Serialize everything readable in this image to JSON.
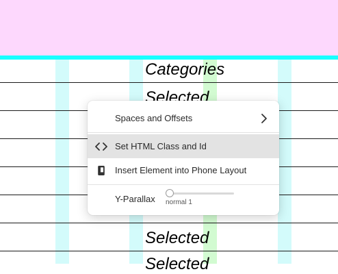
{
  "canvas": {
    "texts": [
      "Categories",
      "Selected",
      "Selected",
      "Selected"
    ]
  },
  "context_menu": {
    "items": [
      {
        "label": "Spaces and Offsets",
        "icon": "chevron-right-icon"
      },
      {
        "label": "Set HTML Class and Id",
        "icon": "code-icon"
      },
      {
        "label": "Insert Element into Phone Layout",
        "icon": "phone-icon"
      }
    ],
    "parallax": {
      "label": "Y-Parallax",
      "value_text": "normal 1",
      "level": 0
    }
  },
  "colors": {
    "header_band": "#fdd8fd",
    "header_bar": "#19ffff",
    "column_cyan": "#d3fbfb",
    "column_green": "#d2fbd1",
    "menu_hover": "#e3e3e3"
  }
}
